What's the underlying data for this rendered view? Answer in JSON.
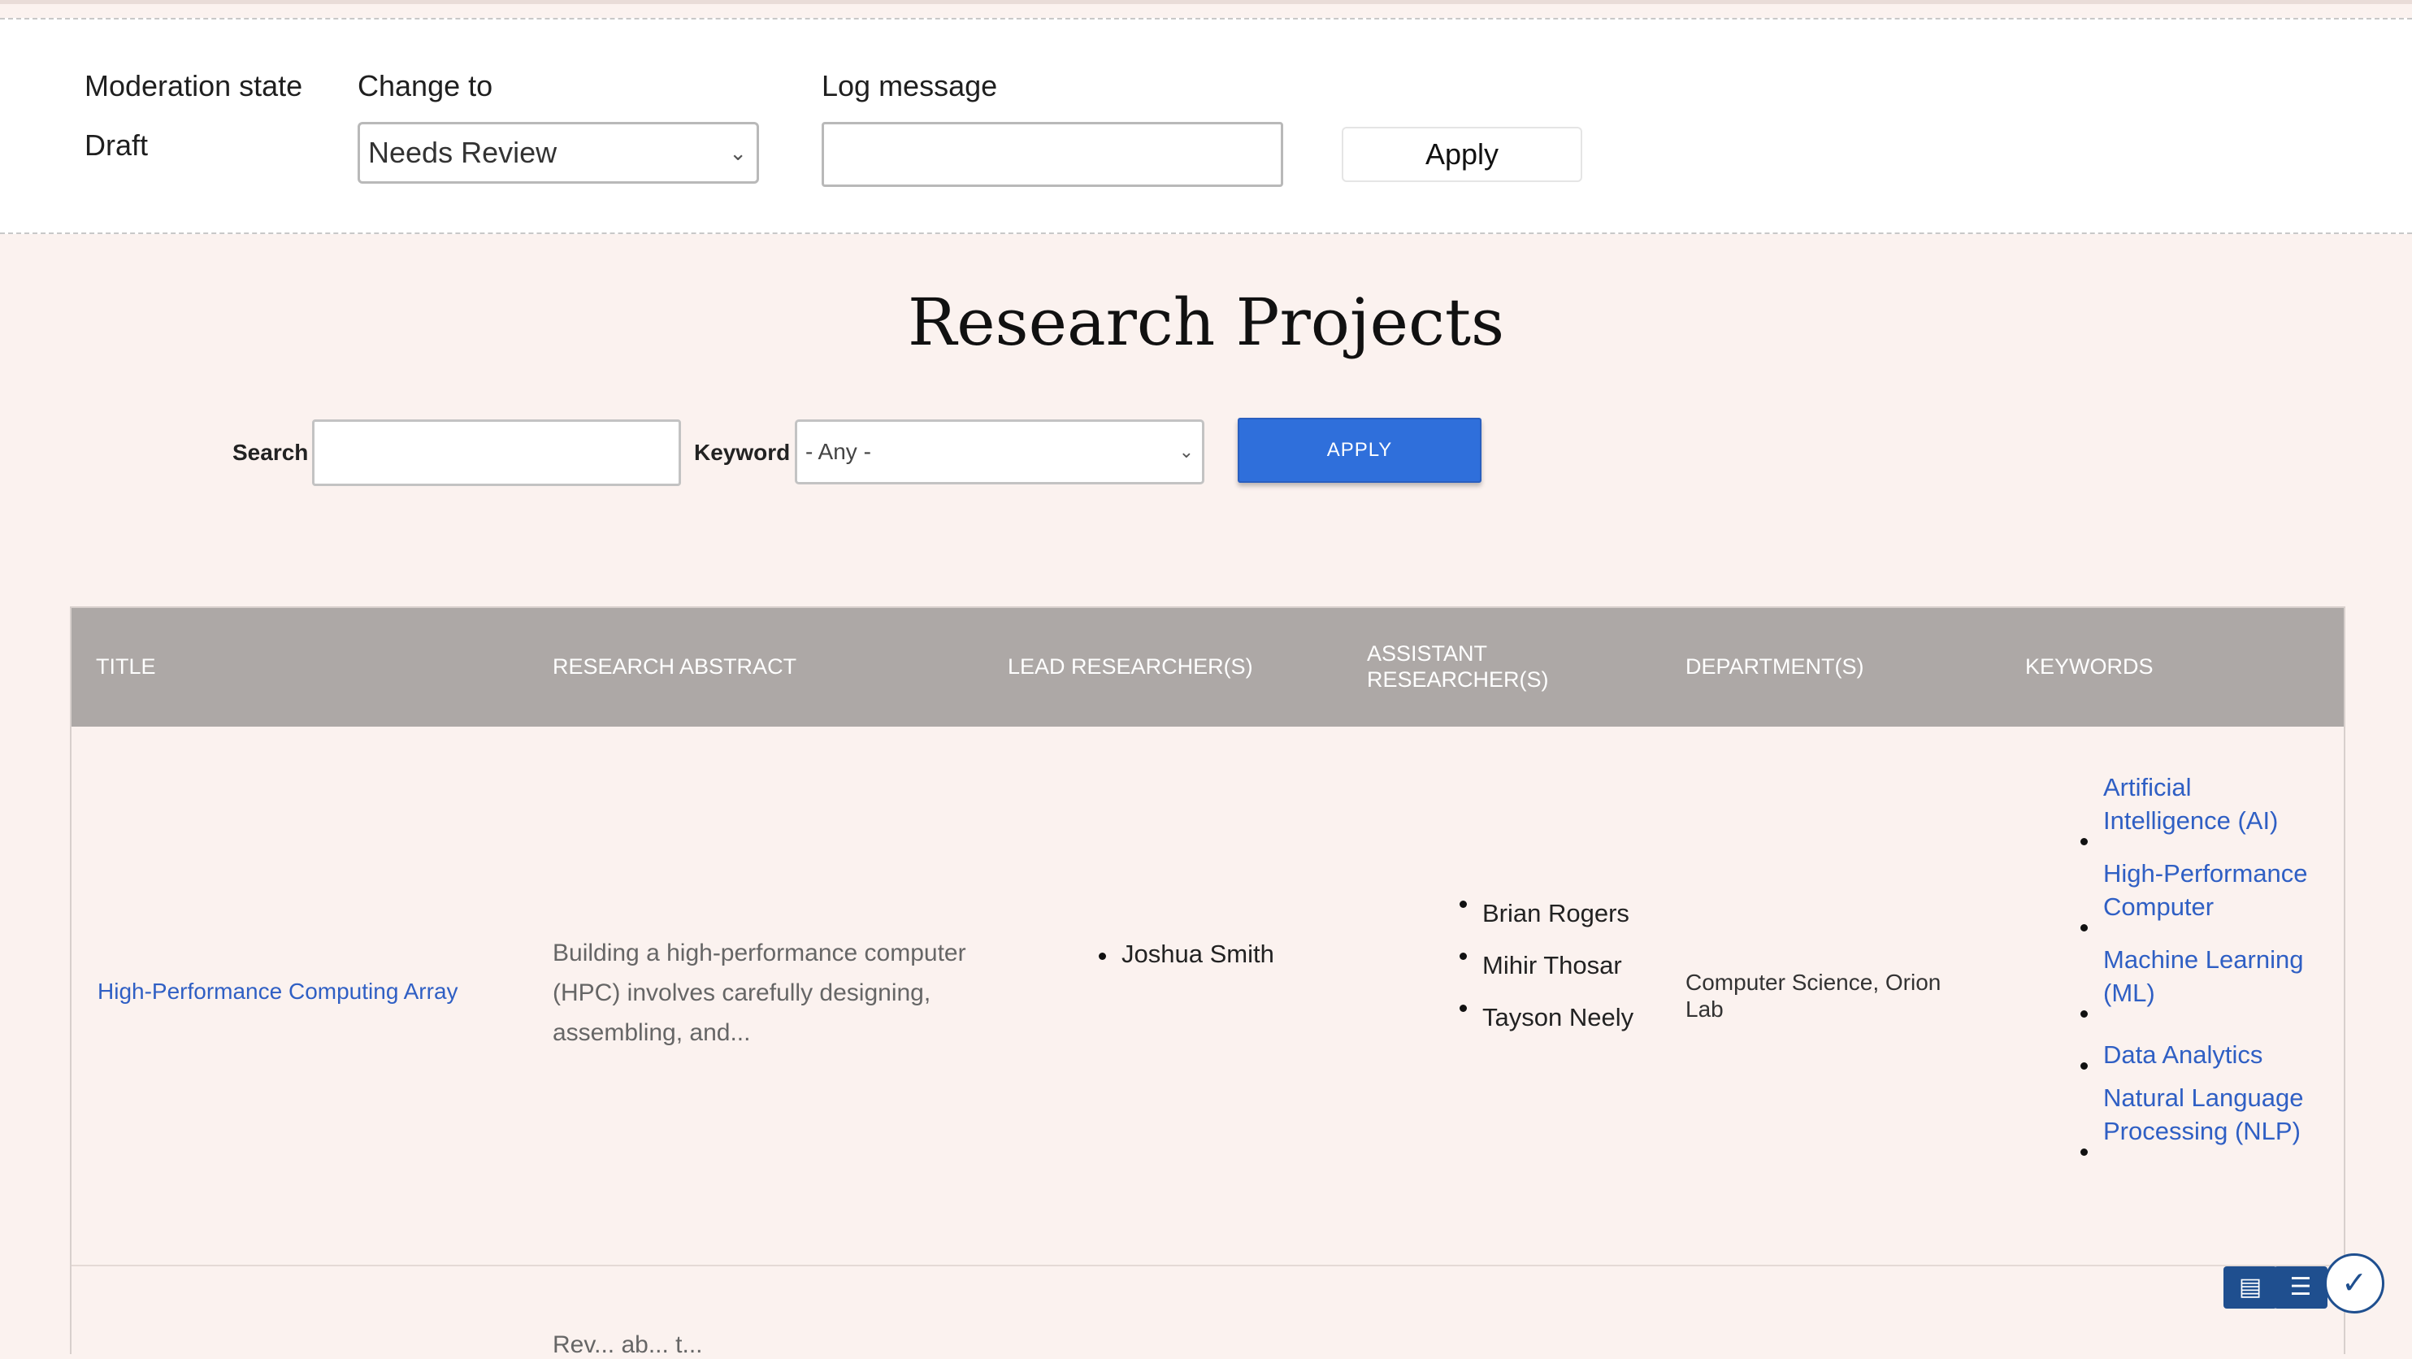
{
  "moderation": {
    "state_label": "Moderation state",
    "state_value": "Draft",
    "change_to_label": "Change to",
    "change_to_value": "Needs Review",
    "log_label": "Log message",
    "log_value": "",
    "apply_label": "Apply"
  },
  "page": {
    "title": "Research Projects"
  },
  "filters": {
    "search_label": "Search",
    "search_value": "",
    "keyword_label": "Keyword",
    "keyword_value": "- Any -",
    "apply_label": "APPLY"
  },
  "table": {
    "columns": {
      "title": "TITLE",
      "abstract": "RESEARCH ABSTRACT",
      "lead": "LEAD RESEARCHER(S)",
      "assistant_line1": "ASSISTANT",
      "assistant_line2": "RESEARCHER(S)",
      "department": "DEPARTMENT(S)",
      "keywords": "KEYWORDS"
    },
    "rows": [
      {
        "title": "High-Performance Computing Array",
        "abstract": "Building a high-performance computer (HPC) involves carefully designing, assembling, and...",
        "lead": [
          "Joshua Smith"
        ],
        "assistant": [
          "Brian Rogers",
          "Mihir Thosar",
          "Tayson Neely"
        ],
        "department": "Computer Science, Orion Lab",
        "keywords": [
          {
            "line1": "Artificial",
            "line2": "Intelligence (AI)"
          },
          {
            "line1": "High-Performance",
            "line2": "Computer"
          },
          {
            "line1": "Machine Learning",
            "line2": "(ML)"
          },
          {
            "line1": "Data Analytics",
            "line2": ""
          },
          {
            "line1": "Natural Language",
            "line2": "Processing (NLP)"
          }
        ]
      },
      {
        "abstract_partial": "Rev... ab... t..."
      }
    ]
  },
  "widget": {
    "icons": [
      "table-icon",
      "checklist-icon",
      "checkmark-icon"
    ],
    "check_glyph": "✓"
  }
}
